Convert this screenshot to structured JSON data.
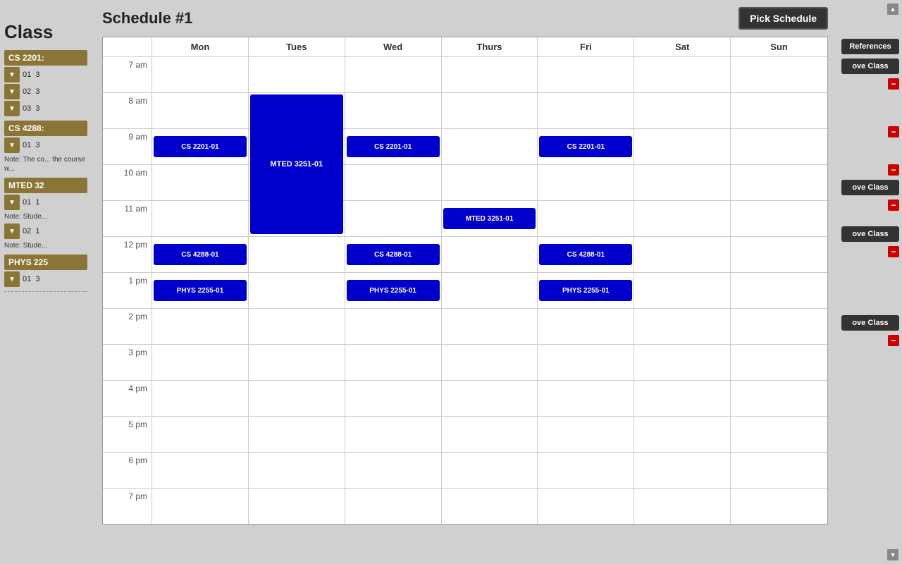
{
  "app": {
    "title": "Class"
  },
  "sidebar": {
    "courses": [
      {
        "id": "cs2201",
        "header": "CS 2201:",
        "sections": [
          {
            "num": "01",
            "credits": "3"
          },
          {
            "num": "02",
            "credits": "3"
          },
          {
            "num": "03",
            "credits": "3"
          }
        ],
        "note": null
      },
      {
        "id": "cs4288",
        "header": "CS 4288:",
        "sections": [
          {
            "num": "01",
            "credits": "3"
          }
        ],
        "note": "The co... the course w..."
      },
      {
        "id": "mted32",
        "header": "MTED 32",
        "sections": [
          {
            "num": "01",
            "credits": "1"
          },
          {
            "num": "02",
            "credits": "1"
          }
        ],
        "note1": "Stude...",
        "note2": "Stude..."
      },
      {
        "id": "phys225",
        "header": "PHYS 225",
        "sections": [
          {
            "num": "01",
            "credits": "3"
          }
        ]
      }
    ]
  },
  "right_sidebar": {
    "buttons": [
      {
        "id": "preferences",
        "label": "References"
      },
      {
        "id": "remove-cs2201",
        "label": "ove Class"
      },
      {
        "id": "remove-cs4288",
        "label": "ove Class"
      },
      {
        "id": "remove-mted32",
        "label": "ove Class"
      },
      {
        "id": "remove-phys225",
        "label": "ove Class"
      }
    ]
  },
  "schedule": {
    "title": "Schedule #1",
    "pick_btn": "Pick Schedule"
  },
  "calendar": {
    "days": [
      "Mon",
      "Tues",
      "Wed",
      "Thurs",
      "Fri",
      "Sat",
      "Sun"
    ],
    "times": [
      "7 am",
      "8 am",
      "9 am",
      "10 am",
      "11 am",
      "12 pm",
      "1 pm",
      "2 pm",
      "3 pm",
      "4 pm",
      "5 pm",
      "6 pm",
      "7 pm"
    ],
    "events": [
      {
        "label": "CS 2201-01",
        "day": 0,
        "timeIndex": 2
      },
      {
        "label": "MTED 3251-01",
        "day": 1,
        "timeIndex": 1,
        "span": 4
      },
      {
        "label": "CS 2201-01",
        "day": 2,
        "timeIndex": 2
      },
      {
        "label": "MTED 3251-01",
        "day": 3,
        "timeIndex": 4
      },
      {
        "label": "CS 2201-01",
        "day": 4,
        "timeIndex": 2
      },
      {
        "label": "CS 4288-01",
        "day": 0,
        "timeIndex": 5
      },
      {
        "label": "CS 4288-01",
        "day": 2,
        "timeIndex": 5
      },
      {
        "label": "CS 4288-01",
        "day": 4,
        "timeIndex": 5
      },
      {
        "label": "PHYS 2255-01",
        "day": 0,
        "timeIndex": 6
      },
      {
        "label": "PHYS 2255-01",
        "day": 2,
        "timeIndex": 6
      },
      {
        "label": "PHYS 2255-01",
        "day": 4,
        "timeIndex": 6
      }
    ]
  }
}
